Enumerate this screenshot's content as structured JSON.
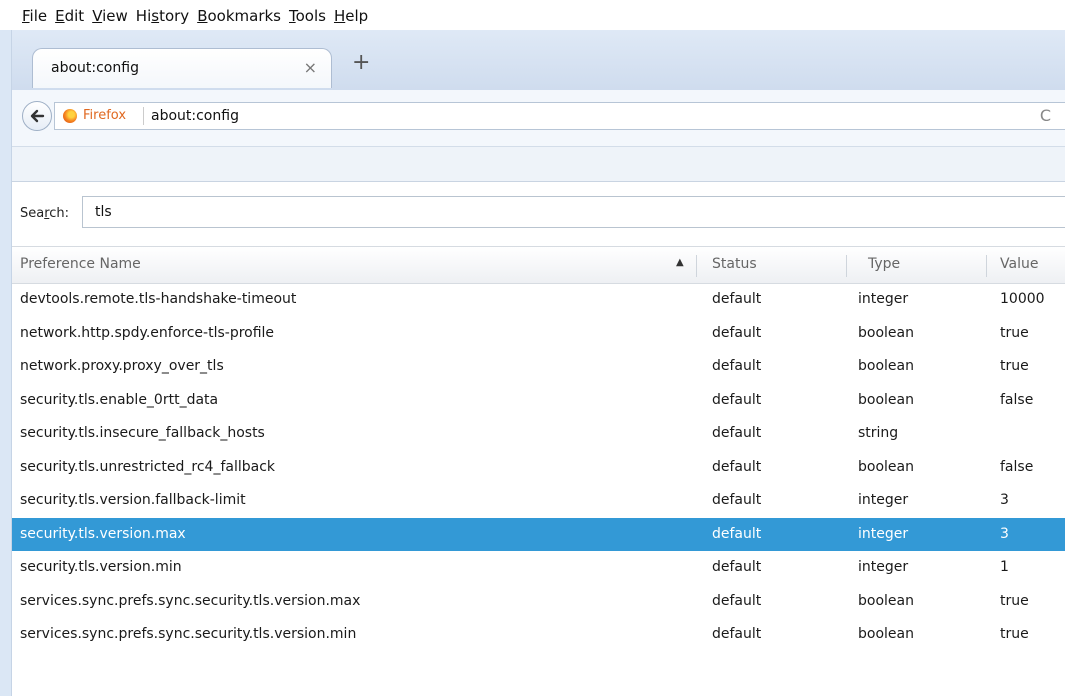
{
  "menubar": {
    "items": [
      {
        "label": "File",
        "accel_index": 0
      },
      {
        "label": "Edit",
        "accel_index": 0
      },
      {
        "label": "View",
        "accel_index": 0
      },
      {
        "label": "History",
        "accel_index": 2
      },
      {
        "label": "Bookmarks",
        "accel_index": 0
      },
      {
        "label": "Tools",
        "accel_index": 0
      },
      {
        "label": "Help",
        "accel_index": 0
      }
    ]
  },
  "tabs": [
    {
      "title": "about:config",
      "active": true
    }
  ],
  "tabbar": {
    "close_glyph": "×",
    "new_tab_glyph": "+"
  },
  "navbar": {
    "back_icon": "back-arrow-icon",
    "identity_label": "Firefox",
    "url": "about:config",
    "reload_glyph": "C"
  },
  "search": {
    "label_before": "Sea",
    "label_accel": "r",
    "label_after": "ch:",
    "value": "tls"
  },
  "table": {
    "columns": {
      "name": "Preference Name",
      "status": "Status",
      "type": "Type",
      "value": "Value"
    },
    "sort_glyph": "▲",
    "rows": [
      {
        "name": "devtools.remote.tls-handshake-timeout",
        "status": "default",
        "type": "integer",
        "value": "10000",
        "selected": false
      },
      {
        "name": "network.http.spdy.enforce-tls-profile",
        "status": "default",
        "type": "boolean",
        "value": "true",
        "selected": false
      },
      {
        "name": "network.proxy.proxy_over_tls",
        "status": "default",
        "type": "boolean",
        "value": "true",
        "selected": false
      },
      {
        "name": "security.tls.enable_0rtt_data",
        "status": "default",
        "type": "boolean",
        "value": "false",
        "selected": false
      },
      {
        "name": "security.tls.insecure_fallback_hosts",
        "status": "default",
        "type": "string",
        "value": "",
        "selected": false
      },
      {
        "name": "security.tls.unrestricted_rc4_fallback",
        "status": "default",
        "type": "boolean",
        "value": "false",
        "selected": false
      },
      {
        "name": "security.tls.version.fallback-limit",
        "status": "default",
        "type": "integer",
        "value": "3",
        "selected": false
      },
      {
        "name": "security.tls.version.max",
        "status": "default",
        "type": "integer",
        "value": "3",
        "selected": true
      },
      {
        "name": "security.tls.version.min",
        "status": "default",
        "type": "integer",
        "value": "1",
        "selected": false
      },
      {
        "name": "services.sync.prefs.sync.security.tls.version.max",
        "status": "default",
        "type": "boolean",
        "value": "true",
        "selected": false
      },
      {
        "name": "services.sync.prefs.sync.security.tls.version.min",
        "status": "default",
        "type": "boolean",
        "value": "true",
        "selected": false
      }
    ]
  },
  "colors": {
    "selection": "#3399d6",
    "identity": "#e06820",
    "chrome": "#dfe9f6"
  }
}
